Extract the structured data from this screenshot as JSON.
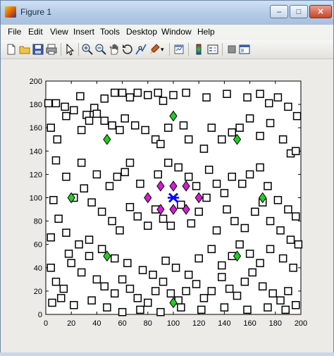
{
  "window": {
    "title": "Figure 1"
  },
  "menu": [
    "File",
    "Edit",
    "View",
    "Insert",
    "Tools",
    "Desktop",
    "Window",
    "Help"
  ],
  "toolbar_icons": [
    "new-figure-icon",
    "open-file-icon",
    "save-icon",
    "print-icon",
    "edit-plot-arrow-icon",
    "zoom-in-icon",
    "zoom-out-icon",
    "pan-icon",
    "rotate-3d-icon",
    "data-cursor-icon",
    "brush-icon",
    "link-plot-icon",
    "insert-colorbar-icon",
    "insert-legend-icon",
    "hide-plot-tools-icon",
    "show-plot-tools-icon"
  ],
  "colors": {
    "diamond_green": "#22cc22",
    "diamond_magenta": "#d21ed2",
    "sink_blue": "#0000ff",
    "square": "#000000"
  },
  "chart_data": {
    "type": "scatter",
    "title": "",
    "xlabel": "",
    "ylabel": "",
    "xlim": [
      0,
      200
    ],
    "ylim": [
      0,
      200
    ],
    "xticks": [
      "0",
      "20",
      "40",
      "60",
      "80",
      "100",
      "120",
      "140",
      "160",
      "180",
      "200"
    ],
    "yticks": [
      "0",
      "20",
      "40",
      "60",
      "80",
      "100",
      "120",
      "140",
      "160",
      "180",
      "200"
    ],
    "grid": false,
    "series": [
      {
        "marker": "square",
        "color": "#000000",
        "points": [
          [
            2,
            181
          ],
          [
            8,
            181
          ],
          [
            15,
            178
          ],
          [
            22,
            175
          ],
          [
            27,
            187
          ],
          [
            32,
            171
          ],
          [
            38,
            177
          ],
          [
            46,
            185
          ],
          [
            54,
            190
          ],
          [
            60,
            190
          ],
          [
            66,
            186
          ],
          [
            72,
            190
          ],
          [
            80,
            188
          ],
          [
            88,
            190
          ],
          [
            92,
            183
          ],
          [
            100,
            188
          ],
          [
            110,
            190
          ],
          [
            126,
            186
          ],
          [
            142,
            189
          ],
          [
            158,
            186
          ],
          [
            168,
            189
          ],
          [
            175,
            181
          ],
          [
            182,
            186
          ],
          [
            190,
            178
          ],
          [
            197,
            170
          ],
          [
            4,
            160
          ],
          [
            9,
            150
          ],
          [
            16,
            170
          ],
          [
            28,
            158
          ],
          [
            34,
            166
          ],
          [
            40,
            172
          ],
          [
            46,
            166
          ],
          [
            52,
            162
          ],
          [
            58,
            158
          ],
          [
            62,
            168
          ],
          [
            70,
            162
          ],
          [
            78,
            158
          ],
          [
            86,
            150
          ],
          [
            90,
            146
          ],
          [
            96,
            160
          ],
          [
            108,
            162
          ],
          [
            112,
            150
          ],
          [
            124,
            142
          ],
          [
            130,
            160
          ],
          [
            138,
            150
          ],
          [
            146,
            156
          ],
          [
            152,
            160
          ],
          [
            160,
            168
          ],
          [
            168,
            153
          ],
          [
            176,
            164
          ],
          [
            186,
            150
          ],
          [
            192,
            138
          ],
          [
            196,
            140
          ],
          [
            8,
            132
          ],
          [
            16,
            118
          ],
          [
            28,
            130
          ],
          [
            40,
            120
          ],
          [
            50,
            110
          ],
          [
            56,
            118
          ],
          [
            62,
            122
          ],
          [
            66,
            130
          ],
          [
            74,
            112
          ],
          [
            88,
            120
          ],
          [
            96,
            130
          ],
          [
            104,
            126
          ],
          [
            112,
            118
          ],
          [
            118,
            110
          ],
          [
            128,
            124
          ],
          [
            134,
            112
          ],
          [
            140,
            104
          ],
          [
            146,
            118
          ],
          [
            154,
            112
          ],
          [
            160,
            120
          ],
          [
            168,
            126
          ],
          [
            174,
            110
          ],
          [
            182,
            98
          ],
          [
            190,
            90
          ],
          [
            196,
            84
          ],
          [
            6,
            98
          ],
          [
            10,
            82
          ],
          [
            16,
            70
          ],
          [
            22,
            100
          ],
          [
            30,
            108
          ],
          [
            36,
            96
          ],
          [
            44,
            88
          ],
          [
            52,
            80
          ],
          [
            58,
            72
          ],
          [
            66,
            92
          ],
          [
            72,
            84
          ],
          [
            80,
            76
          ],
          [
            86,
            90
          ],
          [
            92,
            82
          ],
          [
            98,
            76
          ],
          [
            106,
            94
          ],
          [
            114,
            78
          ],
          [
            120,
            88
          ],
          [
            126,
            100
          ],
          [
            134,
            72
          ],
          [
            142,
            90
          ],
          [
            148,
            80
          ],
          [
            156,
            74
          ],
          [
            164,
            88
          ],
          [
            170,
            96
          ],
          [
            176,
            80
          ],
          [
            184,
            72
          ],
          [
            192,
            64
          ],
          [
            198,
            60
          ],
          [
            4,
            40
          ],
          [
            8,
            28
          ],
          [
            14,
            22
          ],
          [
            20,
            44
          ],
          [
            28,
            36
          ],
          [
            34,
            50
          ],
          [
            40,
            30
          ],
          [
            46,
            24
          ],
          [
            54,
            18
          ],
          [
            60,
            30
          ],
          [
            66,
            22
          ],
          [
            72,
            14
          ],
          [
            80,
            10
          ],
          [
            86,
            20
          ],
          [
            92,
            28
          ],
          [
            98,
            18
          ],
          [
            104,
            12
          ],
          [
            110,
            20
          ],
          [
            118,
            26
          ],
          [
            124,
            14
          ],
          [
            130,
            20
          ],
          [
            138,
            32
          ],
          [
            144,
            22
          ],
          [
            150,
            16
          ],
          [
            156,
            28
          ],
          [
            162,
            36
          ],
          [
            170,
            24
          ],
          [
            178,
            18
          ],
          [
            184,
            12
          ],
          [
            190,
            20
          ],
          [
            196,
            8
          ],
          [
            5,
            10
          ],
          [
            12,
            14
          ],
          [
            22,
            8
          ],
          [
            36,
            12
          ],
          [
            48,
            6
          ],
          [
            60,
            2
          ],
          [
            74,
            4
          ],
          [
            90,
            2
          ],
          [
            106,
            6
          ],
          [
            122,
            4
          ],
          [
            140,
            6
          ],
          [
            158,
            4
          ],
          [
            174,
            6
          ],
          [
            188,
            4
          ],
          [
            4,
            66
          ],
          [
            18,
            52
          ],
          [
            26,
            60
          ],
          [
            34,
            64
          ],
          [
            44,
            56
          ],
          [
            54,
            48
          ],
          [
            64,
            44
          ],
          [
            76,
            38
          ],
          [
            84,
            34
          ],
          [
            94,
            46
          ],
          [
            102,
            40
          ],
          [
            112,
            34
          ],
          [
            120,
            48
          ],
          [
            130,
            56
          ],
          [
            138,
            42
          ],
          [
            146,
            50
          ],
          [
            152,
            60
          ],
          [
            160,
            52
          ],
          [
            168,
            44
          ],
          [
            176,
            56
          ],
          [
            186,
            48
          ],
          [
            194,
            40
          ]
        ]
      },
      {
        "marker": "diamond",
        "color": "#22cc22",
        "points": [
          [
            100,
            170
          ],
          [
            150,
            150
          ],
          [
            48,
            150
          ],
          [
            20,
            100
          ],
          [
            170,
            100
          ],
          [
            48,
            50
          ],
          [
            150,
            50
          ],
          [
            100,
            10
          ]
        ]
      },
      {
        "marker": "diamond",
        "color": "#d21ed2",
        "points": [
          [
            90,
            110
          ],
          [
            100,
            110
          ],
          [
            110,
            110
          ],
          [
            80,
            100
          ],
          [
            120,
            100
          ],
          [
            90,
            90
          ],
          [
            100,
            90
          ],
          [
            110,
            90
          ]
        ]
      },
      {
        "marker": "x",
        "color": "#0000ff",
        "points": [
          [
            100,
            100
          ]
        ]
      }
    ]
  }
}
